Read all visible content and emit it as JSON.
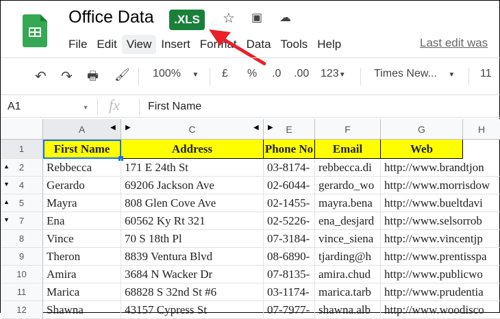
{
  "doc": {
    "title": "Office Data",
    "badge": ".XLS",
    "last_edit": "Last edit was"
  },
  "menu": [
    "File",
    "Edit",
    "View",
    "Insert",
    "Format",
    "Data",
    "Tools",
    "Help"
  ],
  "toolbar": {
    "zoom": "100%",
    "currency": "£",
    "percent": "%",
    "dec_dec": ".0",
    "dec_inc": ".00",
    "format": "123",
    "font": "Times New...",
    "font_size": "11"
  },
  "formula": {
    "cell_ref": "A1",
    "fx": "fx",
    "value": "First Name"
  },
  "columns": [
    "A",
    "C",
    "E",
    "F",
    "G",
    "H"
  ],
  "header_row": {
    "num": "1",
    "cells": [
      "First Name",
      "Address",
      "Phone No",
      "Email",
      "Web"
    ]
  },
  "rows": [
    {
      "num": "2",
      "cells": [
        "Rebbecca",
        "171 E 24th St",
        "03-8174-",
        "rebbecca.di",
        "http://www.brandtjon"
      ]
    },
    {
      "num": "4",
      "cells": [
        "Gerardo",
        "69206 Jackson Ave",
        "02-6044-",
        "gerardo_wo",
        "http://www.morrisdow"
      ]
    },
    {
      "num": "5",
      "cells": [
        "Mayra",
        "808 Glen Cove Ave",
        "02-1455-",
        "mayra.bena",
        "http://www.bueltdavi"
      ]
    },
    {
      "num": "7",
      "cells": [
        "Ena",
        "60562 Ky Rt 321",
        "02-5226-",
        "ena_desjard",
        "http://www.selsorrob"
      ]
    },
    {
      "num": "8",
      "cells": [
        "Vince",
        "70 S 18th Pl",
        "07-3184-",
        "vince_siena",
        "http://www.vincentjp"
      ]
    },
    {
      "num": "9",
      "cells": [
        "Theron",
        "8839 Ventura Blvd",
        "08-6890-",
        "tjarding@h",
        "http://www.prentisspa"
      ]
    },
    {
      "num": "10",
      "cells": [
        "Amira",
        "3684 N Wacker Dr",
        "07-8135-",
        "amira.chud",
        "http://www.publicwo"
      ]
    },
    {
      "num": "11",
      "cells": [
        "Marica",
        "68828 S 32nd St #6",
        "03-1174-",
        "marica.tarb",
        "http://www.prudentia"
      ]
    },
    {
      "num": "12",
      "cells": [
        "Shawna",
        "43157 Cypress St",
        "07-7977-",
        "shawna.alb",
        "http://www.woodisco"
      ]
    }
  ],
  "row_markers": {
    "2": "up",
    "4": "down",
    "5": "up",
    "7": "down"
  },
  "colors": {
    "accent": "#188038",
    "header_fill": "#ffff00",
    "arrow": "#e8202a"
  }
}
